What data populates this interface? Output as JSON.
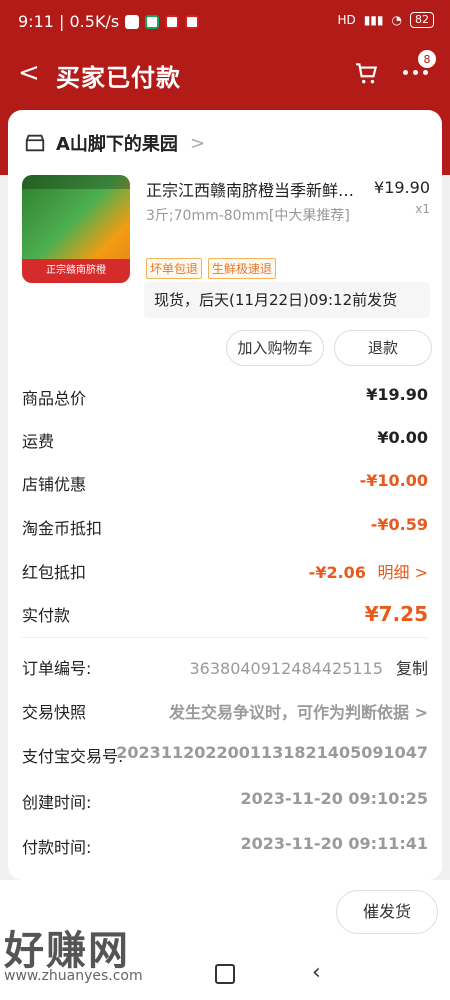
{
  "status": {
    "time": "9:11 | 0.5K/s",
    "battery": "82",
    "signal": "HD"
  },
  "header": {
    "back": "<",
    "title": "买家已付款",
    "cart_badge": "8"
  },
  "shop": {
    "name": "A山脚下的果园",
    "arrow": ">"
  },
  "product": {
    "name": "正宗江西赣南脐橙当季新鲜…",
    "price": "¥19.90",
    "qty": "x1",
    "spec": "3斤;70mm-80mm[中大果推荐]",
    "tags": [
      "坏单包退",
      "生鲜极速退"
    ],
    "shipping": "现货，后天(11月22日)09:12前发货",
    "image_caption": "正宗赣南脐橙"
  },
  "buttons": {
    "add_cart": "加入购物车",
    "refund": "退款",
    "urge": "催发货"
  },
  "summary": {
    "items": [
      {
        "label": "商品总价",
        "value": "¥19.90"
      },
      {
        "label": "运费",
        "value": "¥0.00"
      },
      {
        "label": "店铺优惠",
        "value": "-¥10.00"
      },
      {
        "label": "淘金币抵扣",
        "value": "-¥0.59"
      },
      {
        "label": "红包抵扣",
        "value": "-¥2.06",
        "extra": "明细 >"
      },
      {
        "label": "实付款",
        "value": "¥7.25"
      }
    ]
  },
  "order": {
    "order_no_label": "订单编号:",
    "order_no": "3638040912484425115",
    "copy": "复制",
    "snapshot_label": "交易快照",
    "snapshot_value": "发生交易争议时，可作为判断依据 >",
    "alipay_label": "支付宝交易号:",
    "alipay_no": "2023112022001131821405091047",
    "created_label": "创建时间:",
    "created": "2023-11-20 09:10:25",
    "paid_label": "付款时间:",
    "paid": "2023-11-20 09:11:41"
  },
  "watermark": {
    "cn": "好赚网",
    "url": "www.zhuanyes.com"
  },
  "colors": {
    "brand": "#b21b17",
    "accent": "#e85a1c"
  }
}
